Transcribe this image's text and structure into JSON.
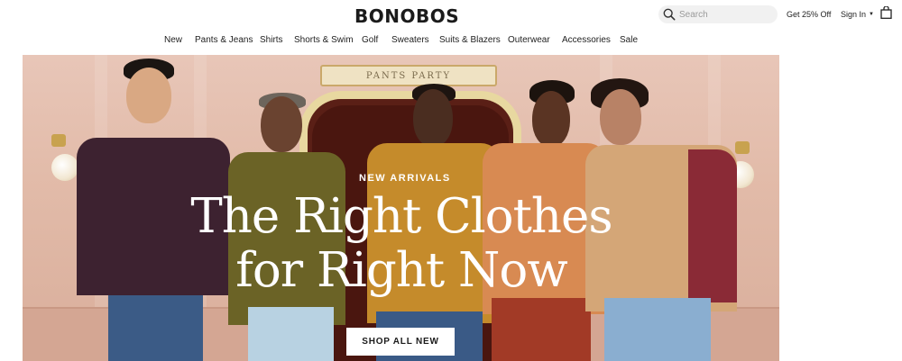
{
  "header": {
    "logo": "BONOBOS",
    "search_placeholder": "Search",
    "promo_label": "Get 25% Off",
    "signin_label": "Sign In",
    "bag_icon": "shopping-bag-icon"
  },
  "nav": {
    "items": [
      {
        "label": "New"
      },
      {
        "label": "Pants & Jeans"
      },
      {
        "label": "Shirts"
      },
      {
        "label": "Shorts & Swim"
      },
      {
        "label": "Golf"
      },
      {
        "label": "Sweaters"
      },
      {
        "label": "Suits & Blazers"
      },
      {
        "label": "Outerwear"
      },
      {
        "label": "Accessories"
      },
      {
        "label": "Sale"
      }
    ]
  },
  "hero": {
    "sign_text": "PANTS PARTY",
    "eyebrow": "NEW ARRIVALS",
    "headline": "The Right Clothes for Right Now",
    "cta_label": "SHOP ALL NEW",
    "colors": {
      "wall": "#e2bba9",
      "door": "#5a1f16",
      "frame": "#e8d8a0"
    }
  }
}
